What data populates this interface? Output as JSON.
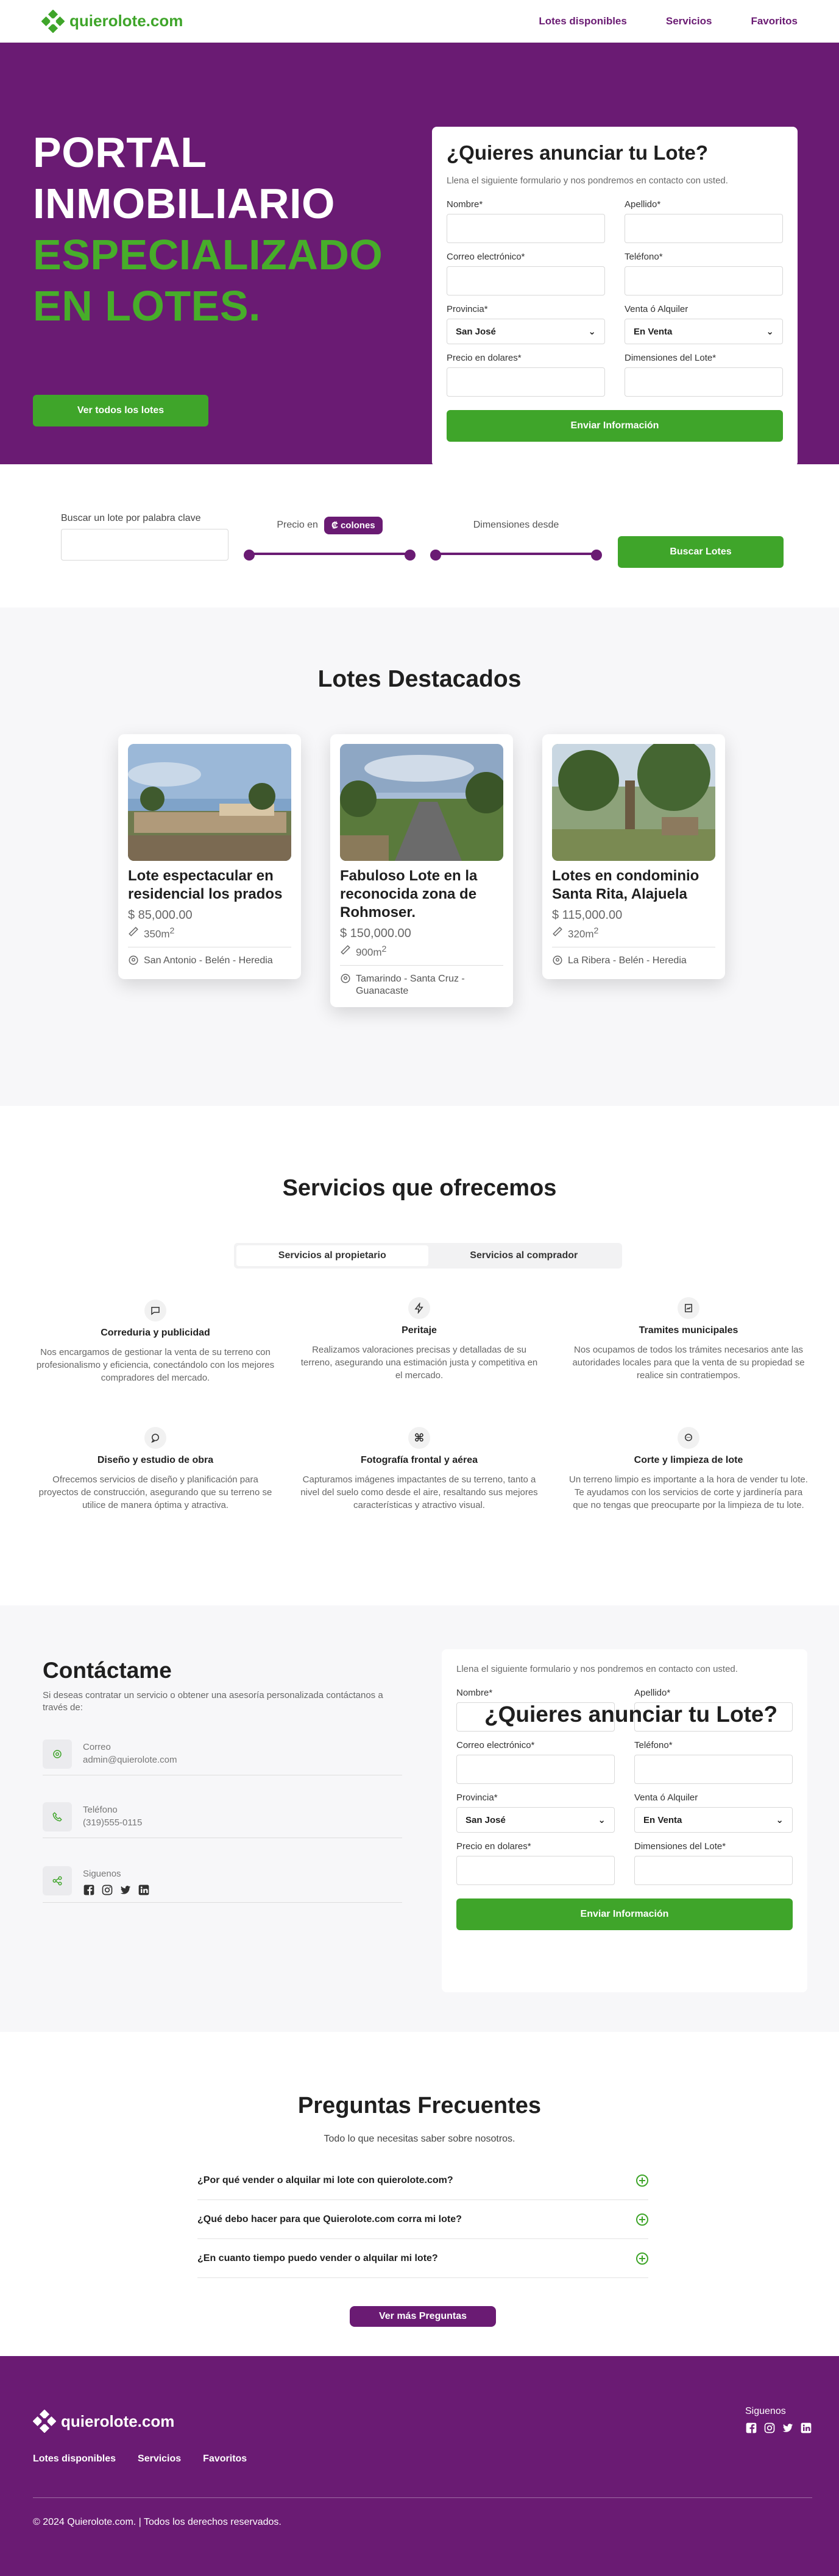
{
  "header": {
    "logo_text": "quierolote.com",
    "nav": [
      "Lotes disponibles",
      "Servicios",
      "Favoritos"
    ]
  },
  "hero": {
    "title_white_1": "PORTAL",
    "title_white_2": "INMOBILIARIO",
    "title_green_1": "ESPECIALIZADO",
    "title_green_2": "EN LOTES.",
    "cta": "Ver todos los lotes"
  },
  "lead_form": {
    "title": "¿Quieres anunciar tu Lote?",
    "subtitle": "Llena el siguiente formulario y nos pondremos en contacto con usted.",
    "name_label": "Nombre*",
    "lastname_label": "Apellido*",
    "email_label": "Correo electrónico*",
    "phone_label": "Teléfono*",
    "province_label": "Provincia*",
    "province_value": "San José",
    "sale_label": "Venta ó Alquiler",
    "sale_value": "En Venta",
    "price_label": "Precio en dolares*",
    "dimensions_label": "Dimensiones del Lote*",
    "submit": "Enviar Información"
  },
  "search": {
    "keyword_label": "Buscar un lote por palabra clave",
    "price_label": "Precio en",
    "currency_pill": "₡ colones",
    "dimensions_label": "Dimensiones desde",
    "button": "Buscar Lotes"
  },
  "featured": {
    "title": "Lotes Destacados",
    "cards": [
      {
        "title": "Lote espectacular en residencial los prados",
        "price": "$ 85,000.00",
        "size": "350m",
        "location": "San Antonio - Belén - Heredia"
      },
      {
        "title": "Fabuloso Lote en la reconocida zona de Rohmoser.",
        "price": "$ 150,000.00",
        "size": "900m",
        "location": "Tamarindo - Santa Cruz - Guanacaste"
      },
      {
        "title": "Lotes en condominio Santa Rita, Alajuela",
        "price": "$ 115,000.00",
        "size": "320m",
        "location": "La Ribera - Belén - Heredia"
      }
    ],
    "size_superscript": "2"
  },
  "services": {
    "title": "Servicios que ofrecemos",
    "tabs": [
      "Servicios al propietario",
      "Servicios al comprador"
    ],
    "items": [
      {
        "icon": "chat-icon",
        "title": "Correduria y publicidad",
        "text": "Nos encargamos de gestionar la venta de su terreno con profesionalismo y eficiencia, conectándolo con los mejores compradores del mercado."
      },
      {
        "icon": "bolt-icon",
        "title": "Peritaje",
        "text": "Realizamos valoraciones precisas y detalladas de su terreno, asegurando una estimación justa y competitiva en el mercado."
      },
      {
        "icon": "document-icon",
        "title": "Tramites municipales",
        "text": "Nos ocupamos de todos los trámites necesarios ante las autoridades locales para que la venta de su propiedad se realice sin contratiempos."
      },
      {
        "icon": "message-icon",
        "title": "Diseño y estudio de obra",
        "text": "Ofrecemos servicios de diseño y planificación para proyectos de construcción, asegurando que su terreno se utilice de manera óptima y atractiva."
      },
      {
        "icon": "command-icon",
        "title": "Fotografía frontal y aérea",
        "text": "Capturamos imágenes impactantes de su terreno, tanto a nivel del suelo como desde el aire, resaltando sus mejores características y atractivo visual."
      },
      {
        "icon": "chat-dots-icon",
        "title": "Corte y limpieza de lote",
        "text": "Un terreno limpio es importante a la hora de vender tu lote. Te ayudamos con los servicios de corte y jardinería para que no tengas que preocuparte por la limpieza de tu lote."
      }
    ]
  },
  "contact": {
    "title": "Contáctame",
    "intro": "Si deseas contratar un servicio o obtener una asesoría personalizada contáctanos a través de:",
    "email_label": "Correo",
    "email_value": "admin@quierolote.com",
    "phone_label": "Teléfono",
    "phone_value": "(319)555-0115",
    "social_label": "Siguenos"
  },
  "faq": {
    "title": "Preguntas Frecuentes",
    "subtitle": "Todo lo que necesitas saber sobre nosotros.",
    "items": [
      "¿Por qué vender o alquilar mi lote con quierolote.com?",
      "¿Qué debo hacer para que Quierolote.com corra mi lote?",
      "¿En cuanto tiempo puedo vender o alquilar mi lote?"
    ],
    "more_button": "Ver más Preguntas"
  },
  "footer": {
    "logo_text": "quierolote.com",
    "links": [
      "Lotes disponibles",
      "Servicios",
      "Favoritos"
    ],
    "social_label": "Siguenos",
    "copyright": "© 2024 Quierolote.com. | Todos los derechos reservados."
  },
  "colors": {
    "purple": "#6a1b73",
    "green": "#3fa52a"
  }
}
